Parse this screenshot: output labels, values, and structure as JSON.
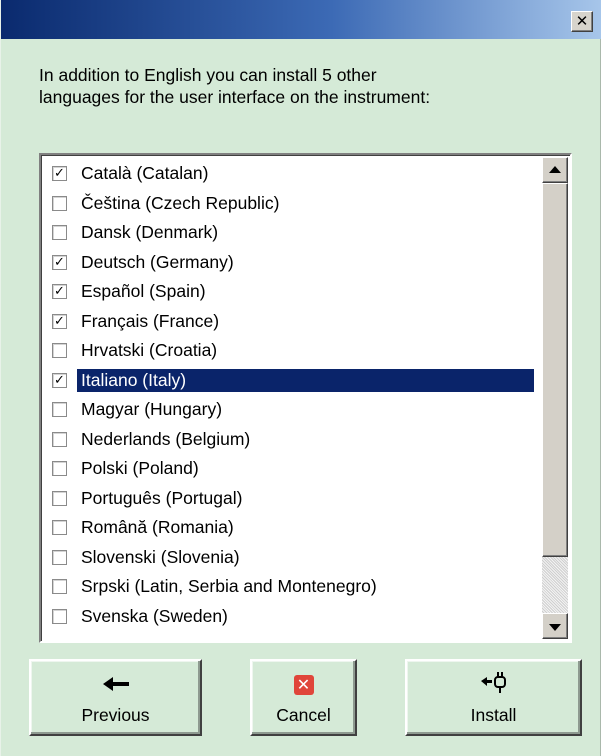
{
  "window": {
    "close_label": "✕"
  },
  "intro": {
    "line1": "In addition to English you can install 5 other",
    "line2": "languages for the user interface on the instrument:"
  },
  "languages": [
    {
      "label": "Català (Catalan)",
      "checked": true,
      "selected": false
    },
    {
      "label": "Čeština (Czech Republic)",
      "checked": false,
      "selected": false
    },
    {
      "label": "Dansk (Denmark)",
      "checked": false,
      "selected": false
    },
    {
      "label": "Deutsch (Germany)",
      "checked": true,
      "selected": false
    },
    {
      "label": "Español (Spain)",
      "checked": true,
      "selected": false
    },
    {
      "label": "Français (France)",
      "checked": true,
      "selected": false
    },
    {
      "label": "Hrvatski (Croatia)",
      "checked": false,
      "selected": false
    },
    {
      "label": "Italiano (Italy)",
      "checked": true,
      "selected": true
    },
    {
      "label": "Magyar (Hungary)",
      "checked": false,
      "selected": false
    },
    {
      "label": "Nederlands (Belgium)",
      "checked": false,
      "selected": false
    },
    {
      "label": "Polski (Poland)",
      "checked": false,
      "selected": false
    },
    {
      "label": "Português (Portugal)",
      "checked": false,
      "selected": false
    },
    {
      "label": "Română (Romania)",
      "checked": false,
      "selected": false
    },
    {
      "label": "Slovenski (Slovenia)",
      "checked": false,
      "selected": false
    },
    {
      "label": "Srpski (Latin, Serbia and Montenegro)",
      "checked": false,
      "selected": false
    },
    {
      "label": "Svenska (Sweden)",
      "checked": false,
      "selected": false
    }
  ],
  "buttons": {
    "previous": {
      "label": "Previous",
      "icon": "arrow-left-icon",
      "glyph": "🠐"
    },
    "cancel": {
      "label": "Cancel",
      "icon": "cancel-x-icon",
      "glyph": "✕"
    },
    "install": {
      "label": "Install",
      "icon": "install-plug-icon",
      "glyph": "⇥"
    }
  },
  "colors": {
    "background": "#d5ead7",
    "selection": "#0a246a",
    "title_start": "#0a2a6e",
    "title_end": "#a7c6ea",
    "cancel_icon": "#e0453a"
  }
}
